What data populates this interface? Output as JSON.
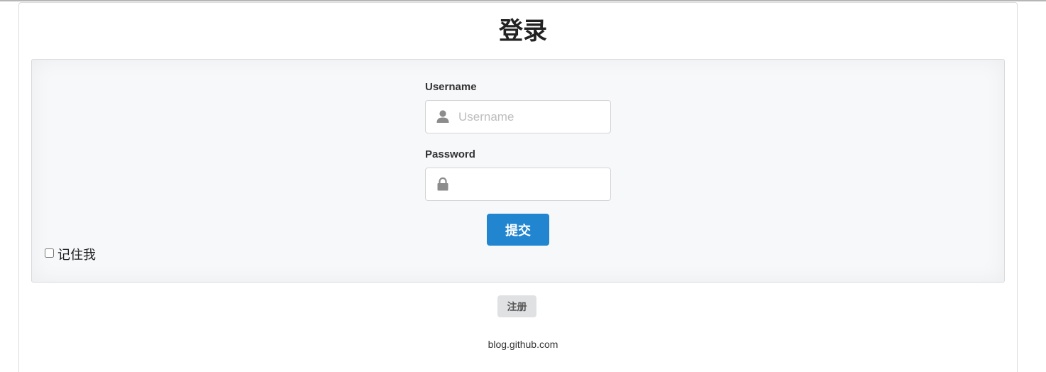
{
  "page": {
    "title": "登录"
  },
  "form": {
    "username": {
      "label": "Username",
      "placeholder": "Username",
      "value": "",
      "icon": "user-icon"
    },
    "password": {
      "label": "Password",
      "placeholder": "",
      "value": "",
      "icon": "lock-icon"
    },
    "submit_label": "提交",
    "remember_label": "记住我",
    "remember_checked": false
  },
  "register_label": "注册",
  "footer": {
    "text": "blog.github.com"
  },
  "colors": {
    "primary": "#2185d0",
    "panel_bg": "#f7f8fa",
    "secondary_button": "#e0e1e2"
  }
}
